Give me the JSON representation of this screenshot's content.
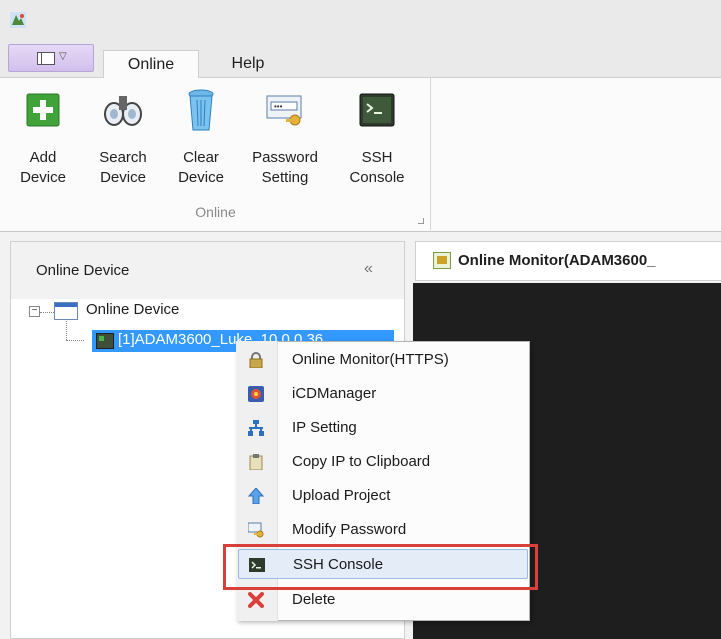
{
  "tabs": {
    "online": "Online",
    "help": "Help"
  },
  "ribbon": {
    "group_label": "Online",
    "buttons": [
      {
        "label": "Add\nDevice",
        "icon": "add-device-icon"
      },
      {
        "label": "Search\nDevice",
        "icon": "binoculars-icon"
      },
      {
        "label": "Clear\nDevice",
        "icon": "trash-can-icon"
      },
      {
        "label": "Password\nSetting",
        "icon": "password-key-icon"
      },
      {
        "label": "SSH\nConsole",
        "icon": "terminal-icon"
      }
    ]
  },
  "left_pane": {
    "title": "Online Device",
    "collapse": "«",
    "tree": {
      "expander": "−",
      "root_label": "Online Device",
      "device_label": "[1]ADAM3600_Luke_10.0.0.36"
    }
  },
  "doc_tab": {
    "label": "Online Monitor(ADAM3600_"
  },
  "context_menu": {
    "items": [
      {
        "label": "Online Monitor(HTTPS)",
        "icon": "lock-icon"
      },
      {
        "label": "iCDManager",
        "icon": "icdmanager-icon"
      },
      {
        "label": "IP Setting",
        "icon": "network-icon"
      },
      {
        "label": "Copy IP to Clipboard",
        "icon": "clipboard-icon"
      },
      {
        "label": "Upload Project",
        "icon": "upload-arrow-icon"
      },
      {
        "label": "Modify Password",
        "icon": "password-key-icon"
      },
      {
        "label": "SSH Console",
        "icon": "terminal-icon"
      },
      {
        "label": "Delete",
        "icon": "delete-x-icon"
      }
    ],
    "highlighted_index": 6
  },
  "colors": {
    "selection": "#3399ff",
    "highlight_border": "#d9403a",
    "console_bg": "#1e1e1e"
  }
}
